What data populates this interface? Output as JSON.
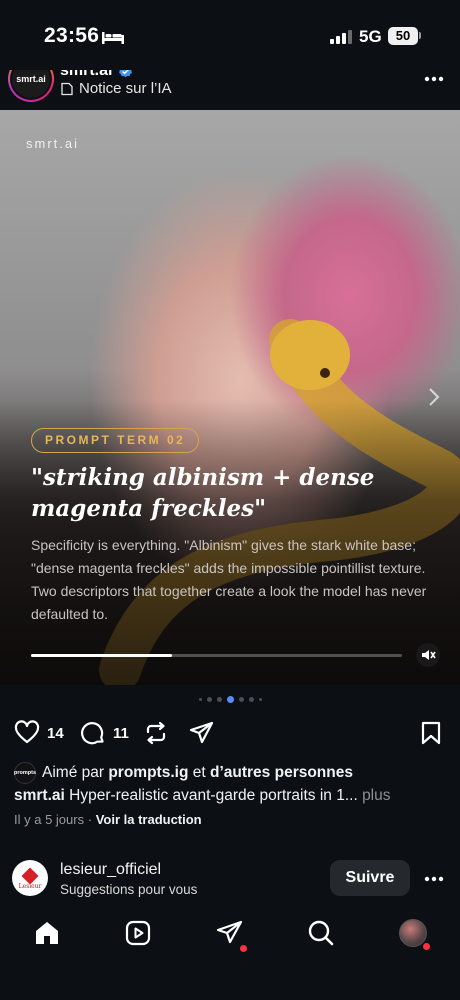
{
  "status_bar": {
    "time": "23:56",
    "network": "5G",
    "battery": "50",
    "icons": [
      "bed-icon",
      "signal-bars-icon"
    ]
  },
  "post": {
    "avatar_text": "smrt.ai",
    "username": "smrt.ai",
    "ai_notice": "Notice sur l’IA"
  },
  "media": {
    "watermark": "smrt.ai",
    "term_badge": "PROMPT TERM 02",
    "headline": "\"striking albinism + dense magenta freckles\"",
    "description": "Specificity is everything. \"Albinism\" gives the stark white base; \"dense magenta freckles\" adds the impossible pointillist texture. Two descriptors that together create a look the model has never defaulted to.",
    "video_progress": 0.38,
    "accent_color": "#d6a44a"
  },
  "carousel": {
    "count": 7,
    "active": 3
  },
  "actions": {
    "likes": "14",
    "comments": "11"
  },
  "likes_line": {
    "avatar_text": "prompts",
    "prefix": "Aimé par",
    "user": "prompts.ig",
    "connector": "et",
    "others": "d’autres personnes"
  },
  "caption": {
    "user": "smrt.ai",
    "text": "Hyper-realistic avant-garde portraits in 1...",
    "more": "plus"
  },
  "meta": {
    "time_ago": "Il y a 5 jours",
    "separator": "·",
    "translate": "Voir la traduction"
  },
  "suggestion": {
    "logo_text": "Lesieur",
    "username": "lesieur_officiel",
    "subtitle": "Suggestions pour vous",
    "follow_label": "Suivre"
  },
  "nav": {
    "items": [
      "home-icon",
      "reels-icon",
      "direct-messages-icon",
      "search-icon",
      "profile-avatar"
    ]
  }
}
